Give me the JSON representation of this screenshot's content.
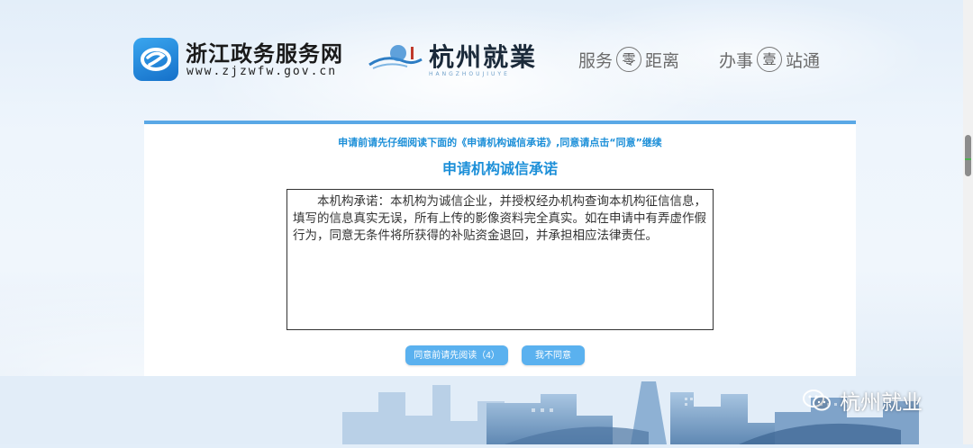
{
  "header": {
    "zj_title": "浙江政务服务网",
    "zj_url": "www.zjzwfw.gov.cn",
    "hz_title": "杭州就業",
    "hz_sub": "HANGZHOUJIUYE",
    "slogan1": {
      "before": "服务",
      "circle": "零",
      "after": "距离"
    },
    "slogan2": {
      "before": "办事",
      "circle": "壹",
      "after": "站通"
    }
  },
  "panel": {
    "notice": "申请前请先仔细阅读下面的《申请机构诚信承诺》,同意请点击“同意”继续",
    "heading": "申请机构诚信承诺",
    "commitment_text": "本机构承诺：本机构为诚信企业，并授权经办机构查询本机构征信信息，填写的信息真实无误，所有上传的影像资料完全真实。如在申请中有弄虚作假行为，同意无条件将所获得的补贴资金退回，并承担相应法律责任。",
    "agree_button": "同意前请先阅读（4）",
    "disagree_button": "我不同意"
  },
  "watermark": {
    "text": "杭州就业"
  },
  "colors": {
    "accent": "#1c8fd8",
    "button": "#5ab1ef",
    "panel_border": "#5aa8e6"
  }
}
